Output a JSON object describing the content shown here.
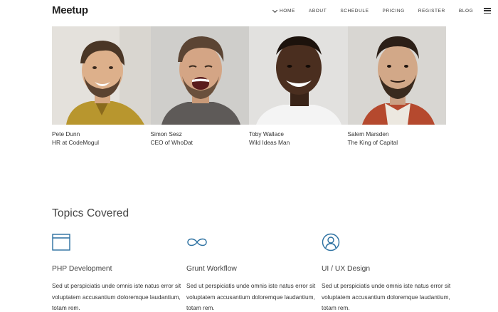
{
  "brand": {
    "logo": "Meetup"
  },
  "nav": {
    "items": [
      {
        "label": "HOME",
        "active": true
      },
      {
        "label": "ABOUT"
      },
      {
        "label": "SCHEDULE"
      },
      {
        "label": "PRICING"
      },
      {
        "label": "REGISTER"
      },
      {
        "label": "BLOG"
      }
    ]
  },
  "team": [
    {
      "name": "Pete Dunn",
      "role": "HR at CodeMogul"
    },
    {
      "name": "Simon Sesz",
      "role": "CEO of WhoDat"
    },
    {
      "name": "Toby Wallace",
      "role": "Wild Ideas Man"
    },
    {
      "name": "Salem Marsden",
      "role": "The King of Capital"
    }
  ],
  "topics": {
    "title": "Topics Covered",
    "items": [
      {
        "icon": "browser-window-icon",
        "title": "PHP Development",
        "description": "Sed ut perspiciatis unde omnis iste natus error sit voluptatem accusantium doloremque laudantium, totam rem."
      },
      {
        "icon": "infinity-icon",
        "title": "Grunt Workflow",
        "description": "Sed ut perspiciatis unde omnis iste natus error sit voluptatem accusantium doloremque laudantium, totam rem."
      },
      {
        "icon": "user-circle-icon",
        "title": "UI / UX Design",
        "description": "Sed ut perspiciatis unde omnis iste natus error sit voluptatem accusantium doloremque laudantium, totam rem."
      }
    ]
  },
  "colors": {
    "accent": "#2a6fa0",
    "text": "#333333"
  }
}
